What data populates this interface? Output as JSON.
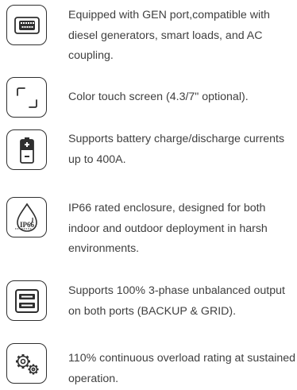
{
  "features": [
    {
      "icon": "gen-port-icon",
      "text": "Equipped with GEN port,compatible with diesel generators, smart loads, and AC coupling."
    },
    {
      "icon": "touch-screen-icon",
      "text": "Color touch screen (4.3/7\" optional)."
    },
    {
      "icon": "battery-icon",
      "text": "Supports battery charge/discharge currents up to 400A."
    },
    {
      "icon": "ip66-enclosure-icon",
      "icon_label": "IP66",
      "text": "IP66 rated enclosure, designed for both indoor and outdoor deployment in harsh environments."
    },
    {
      "icon": "dual-port-output-icon",
      "text": "Supports 100% 3-phase unbalanced output on both ports (BACKUP & GRID)."
    },
    {
      "icon": "gears-icon",
      "text": "110% continuous overload rating at sustained operation."
    }
  ]
}
